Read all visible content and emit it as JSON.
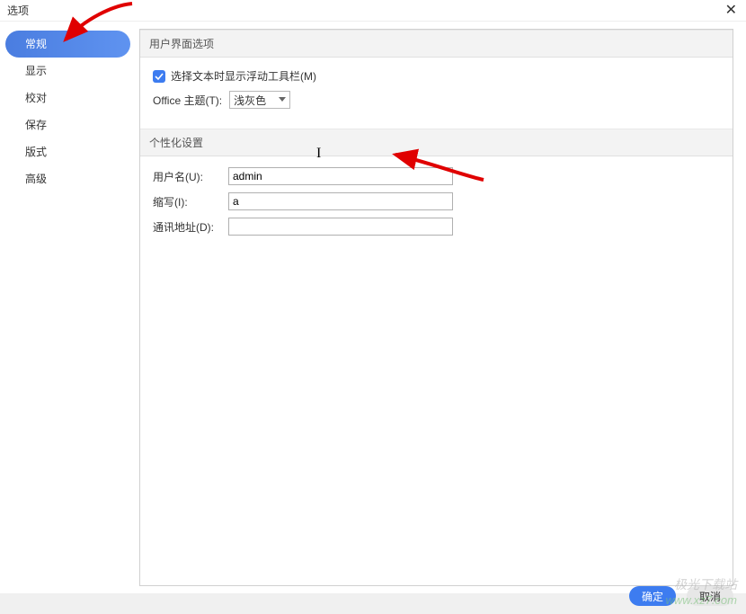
{
  "titlebar": {
    "title": "选项"
  },
  "sidebar": {
    "items": [
      {
        "label": "常规",
        "active": true
      },
      {
        "label": "显示",
        "active": false
      },
      {
        "label": "校对",
        "active": false
      },
      {
        "label": "保存",
        "active": false
      },
      {
        "label": "版式",
        "active": false
      },
      {
        "label": "高级",
        "active": false
      }
    ]
  },
  "sections": {
    "ui_options": {
      "header": "用户界面选项",
      "checkbox_label": "选择文本时显示浮动工具栏(M)",
      "theme_label": "Office 主题(T):",
      "theme_value": "浅灰色"
    },
    "personalization": {
      "header": "个性化设置",
      "username_label": "用户名(U):",
      "username_value": "admin",
      "abbr_label": "缩写(I):",
      "abbr_value": "a",
      "address_label": "通讯地址(D):",
      "address_value": ""
    }
  },
  "footer": {
    "ok_label": "确定",
    "cancel_label": "取消"
  },
  "watermark": {
    "line1": "极光下载站",
    "line2": "www.xz7.com"
  }
}
